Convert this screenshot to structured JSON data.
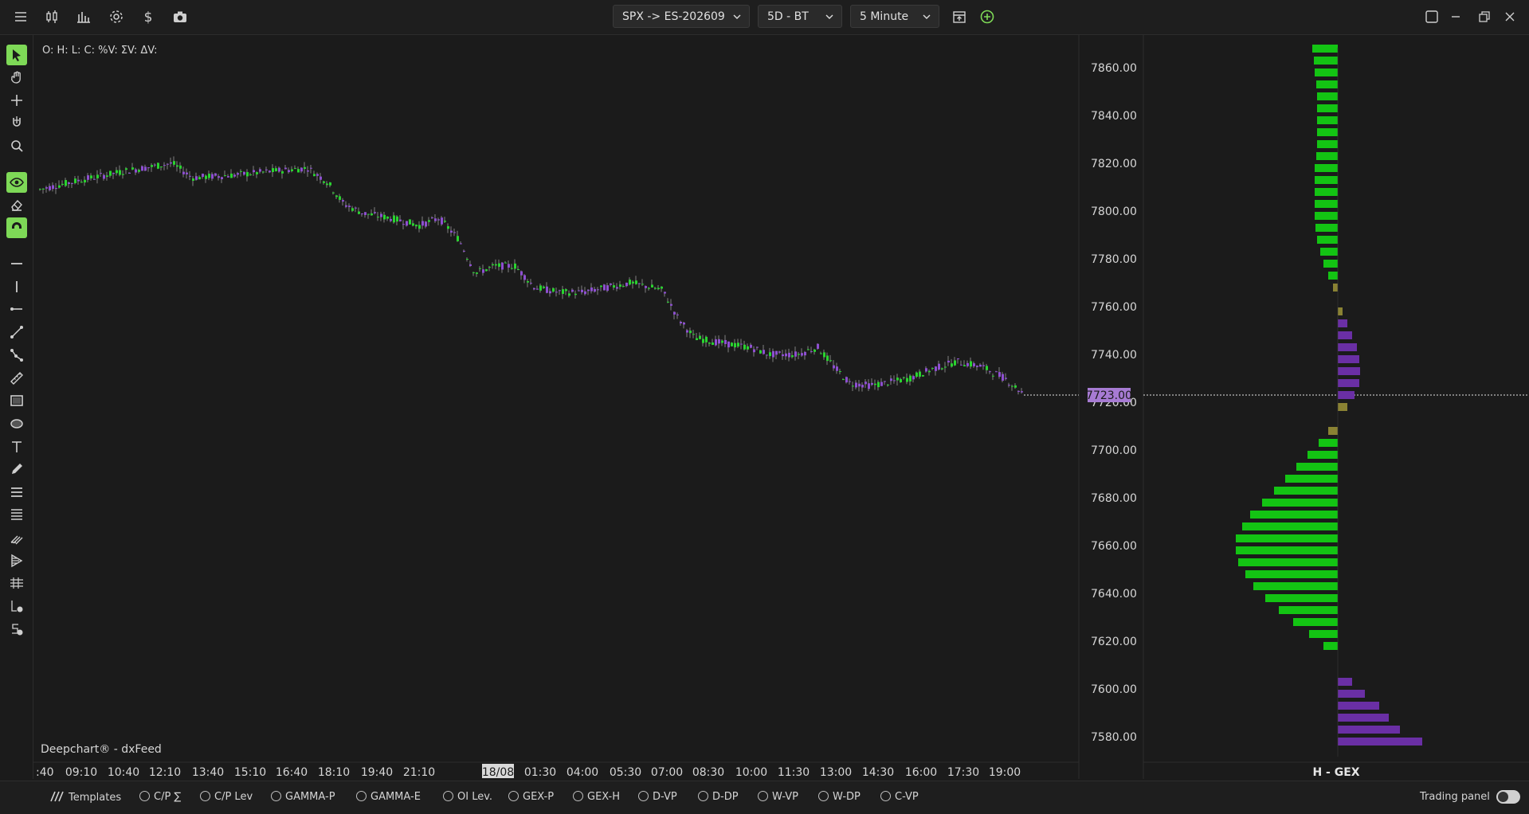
{
  "toolbar": {
    "symbol": "SPX -> ES-202609",
    "range": "5D - BT",
    "interval": "5 Minute"
  },
  "chart": {
    "ohlc_label": "O: H: L: C: %V: ΣV: ΔV:",
    "credit": "Deepchart® - dxFeed",
    "price_tag": "7723.00",
    "y_ticks": [
      "7860.00",
      "7840.00",
      "7820.00",
      "7800.00",
      "7780.00",
      "7760.00",
      "7740.00",
      "7720.00",
      "7700.00",
      "7680.00",
      "7660.00",
      "7640.00",
      "7620.00",
      "7600.00",
      "7580.00"
    ],
    "x_ticks": [
      ":40",
      "09:10",
      "10:40",
      "12:10",
      "13:40",
      "15:10",
      "16:40",
      "18:10",
      "19:40",
      "21:10",
      "18/08",
      "01:30",
      "04:00",
      "05:30",
      "07:00",
      "08:30",
      "10:00",
      "11:30",
      "13:00",
      "14:30",
      "16:00",
      "17:30",
      "19:00"
    ],
    "gex_label": "H - GEX"
  },
  "colors": {
    "up": "#29d32f",
    "down": "#8d4fd0",
    "gex_pos": "#13c413",
    "gex_neg": "#6a2fa5",
    "gex_flip": "#8a8233",
    "accent": "#7ed957"
  },
  "bottom": {
    "templates": "Templates",
    "items": [
      "C/P ∑",
      "C/P Lev",
      "GAMMA-P",
      "GAMMA-E",
      "OI Lev.",
      "GEX-P",
      "GEX-H",
      "D-VP",
      "D-DP",
      "W-VP",
      "W-DP",
      "C-VP"
    ],
    "trading_panel": "Trading panel"
  },
  "icons": [
    "menu-icon",
    "candles-icon",
    "bars-icon",
    "gear-icon",
    "dollar-icon",
    "camera-icon",
    "calendar-icon",
    "add-icon",
    "maximize-icon",
    "minimize-icon",
    "restore-icon",
    "close-icon"
  ]
}
